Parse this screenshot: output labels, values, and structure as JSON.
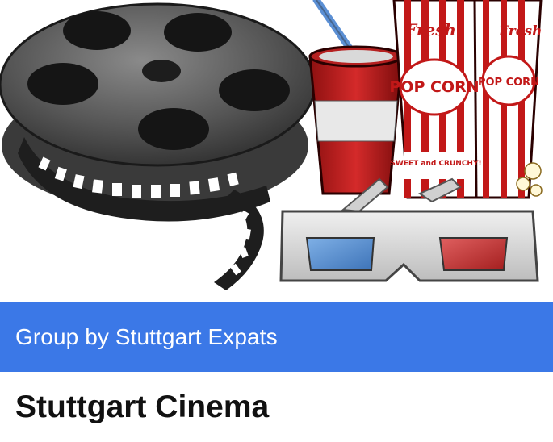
{
  "hero": {
    "image_name": "cinema-illustration",
    "popcorn_label_top": "Fresh",
    "popcorn_label_main": "POP CORN",
    "popcorn_tagline": "SWEET and CRUNCHY!",
    "icon_names": [
      "film-reel-icon",
      "soda-cup-icon",
      "popcorn-box-icon",
      "3d-glasses-icon"
    ]
  },
  "banner": {
    "text": "Group by Stuttgart Expats",
    "color": "#3b78e7"
  },
  "title": "Stuttgart Cinema"
}
